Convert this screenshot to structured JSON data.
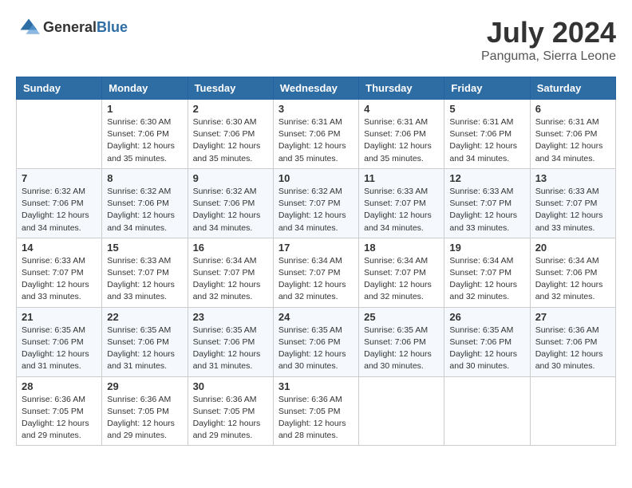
{
  "logo": {
    "general": "General",
    "blue": "Blue"
  },
  "title": {
    "month_year": "July 2024",
    "location": "Panguma, Sierra Leone"
  },
  "days_of_week": [
    "Sunday",
    "Monday",
    "Tuesday",
    "Wednesday",
    "Thursday",
    "Friday",
    "Saturday"
  ],
  "weeks": [
    [
      {
        "day": "",
        "info": ""
      },
      {
        "day": "1",
        "info": "Sunrise: 6:30 AM\nSunset: 7:06 PM\nDaylight: 12 hours\nand 35 minutes."
      },
      {
        "day": "2",
        "info": "Sunrise: 6:30 AM\nSunset: 7:06 PM\nDaylight: 12 hours\nand 35 minutes."
      },
      {
        "day": "3",
        "info": "Sunrise: 6:31 AM\nSunset: 7:06 PM\nDaylight: 12 hours\nand 35 minutes."
      },
      {
        "day": "4",
        "info": "Sunrise: 6:31 AM\nSunset: 7:06 PM\nDaylight: 12 hours\nand 35 minutes."
      },
      {
        "day": "5",
        "info": "Sunrise: 6:31 AM\nSunset: 7:06 PM\nDaylight: 12 hours\nand 34 minutes."
      },
      {
        "day": "6",
        "info": "Sunrise: 6:31 AM\nSunset: 7:06 PM\nDaylight: 12 hours\nand 34 minutes."
      }
    ],
    [
      {
        "day": "7",
        "info": "Sunrise: 6:32 AM\nSunset: 7:06 PM\nDaylight: 12 hours\nand 34 minutes."
      },
      {
        "day": "8",
        "info": "Sunrise: 6:32 AM\nSunset: 7:06 PM\nDaylight: 12 hours\nand 34 minutes."
      },
      {
        "day": "9",
        "info": "Sunrise: 6:32 AM\nSunset: 7:06 PM\nDaylight: 12 hours\nand 34 minutes."
      },
      {
        "day": "10",
        "info": "Sunrise: 6:32 AM\nSunset: 7:07 PM\nDaylight: 12 hours\nand 34 minutes."
      },
      {
        "day": "11",
        "info": "Sunrise: 6:33 AM\nSunset: 7:07 PM\nDaylight: 12 hours\nand 34 minutes."
      },
      {
        "day": "12",
        "info": "Sunrise: 6:33 AM\nSunset: 7:07 PM\nDaylight: 12 hours\nand 33 minutes."
      },
      {
        "day": "13",
        "info": "Sunrise: 6:33 AM\nSunset: 7:07 PM\nDaylight: 12 hours\nand 33 minutes."
      }
    ],
    [
      {
        "day": "14",
        "info": "Sunrise: 6:33 AM\nSunset: 7:07 PM\nDaylight: 12 hours\nand 33 minutes."
      },
      {
        "day": "15",
        "info": "Sunrise: 6:33 AM\nSunset: 7:07 PM\nDaylight: 12 hours\nand 33 minutes."
      },
      {
        "day": "16",
        "info": "Sunrise: 6:34 AM\nSunset: 7:07 PM\nDaylight: 12 hours\nand 32 minutes."
      },
      {
        "day": "17",
        "info": "Sunrise: 6:34 AM\nSunset: 7:07 PM\nDaylight: 12 hours\nand 32 minutes."
      },
      {
        "day": "18",
        "info": "Sunrise: 6:34 AM\nSunset: 7:07 PM\nDaylight: 12 hours\nand 32 minutes."
      },
      {
        "day": "19",
        "info": "Sunrise: 6:34 AM\nSunset: 7:07 PM\nDaylight: 12 hours\nand 32 minutes."
      },
      {
        "day": "20",
        "info": "Sunrise: 6:34 AM\nSunset: 7:06 PM\nDaylight: 12 hours\nand 32 minutes."
      }
    ],
    [
      {
        "day": "21",
        "info": "Sunrise: 6:35 AM\nSunset: 7:06 PM\nDaylight: 12 hours\nand 31 minutes."
      },
      {
        "day": "22",
        "info": "Sunrise: 6:35 AM\nSunset: 7:06 PM\nDaylight: 12 hours\nand 31 minutes."
      },
      {
        "day": "23",
        "info": "Sunrise: 6:35 AM\nSunset: 7:06 PM\nDaylight: 12 hours\nand 31 minutes."
      },
      {
        "day": "24",
        "info": "Sunrise: 6:35 AM\nSunset: 7:06 PM\nDaylight: 12 hours\nand 30 minutes."
      },
      {
        "day": "25",
        "info": "Sunrise: 6:35 AM\nSunset: 7:06 PM\nDaylight: 12 hours\nand 30 minutes."
      },
      {
        "day": "26",
        "info": "Sunrise: 6:35 AM\nSunset: 7:06 PM\nDaylight: 12 hours\nand 30 minutes."
      },
      {
        "day": "27",
        "info": "Sunrise: 6:36 AM\nSunset: 7:06 PM\nDaylight: 12 hours\nand 30 minutes."
      }
    ],
    [
      {
        "day": "28",
        "info": "Sunrise: 6:36 AM\nSunset: 7:05 PM\nDaylight: 12 hours\nand 29 minutes."
      },
      {
        "day": "29",
        "info": "Sunrise: 6:36 AM\nSunset: 7:05 PM\nDaylight: 12 hours\nand 29 minutes."
      },
      {
        "day": "30",
        "info": "Sunrise: 6:36 AM\nSunset: 7:05 PM\nDaylight: 12 hours\nand 29 minutes."
      },
      {
        "day": "31",
        "info": "Sunrise: 6:36 AM\nSunset: 7:05 PM\nDaylight: 12 hours\nand 28 minutes."
      },
      {
        "day": "",
        "info": ""
      },
      {
        "day": "",
        "info": ""
      },
      {
        "day": "",
        "info": ""
      }
    ]
  ]
}
